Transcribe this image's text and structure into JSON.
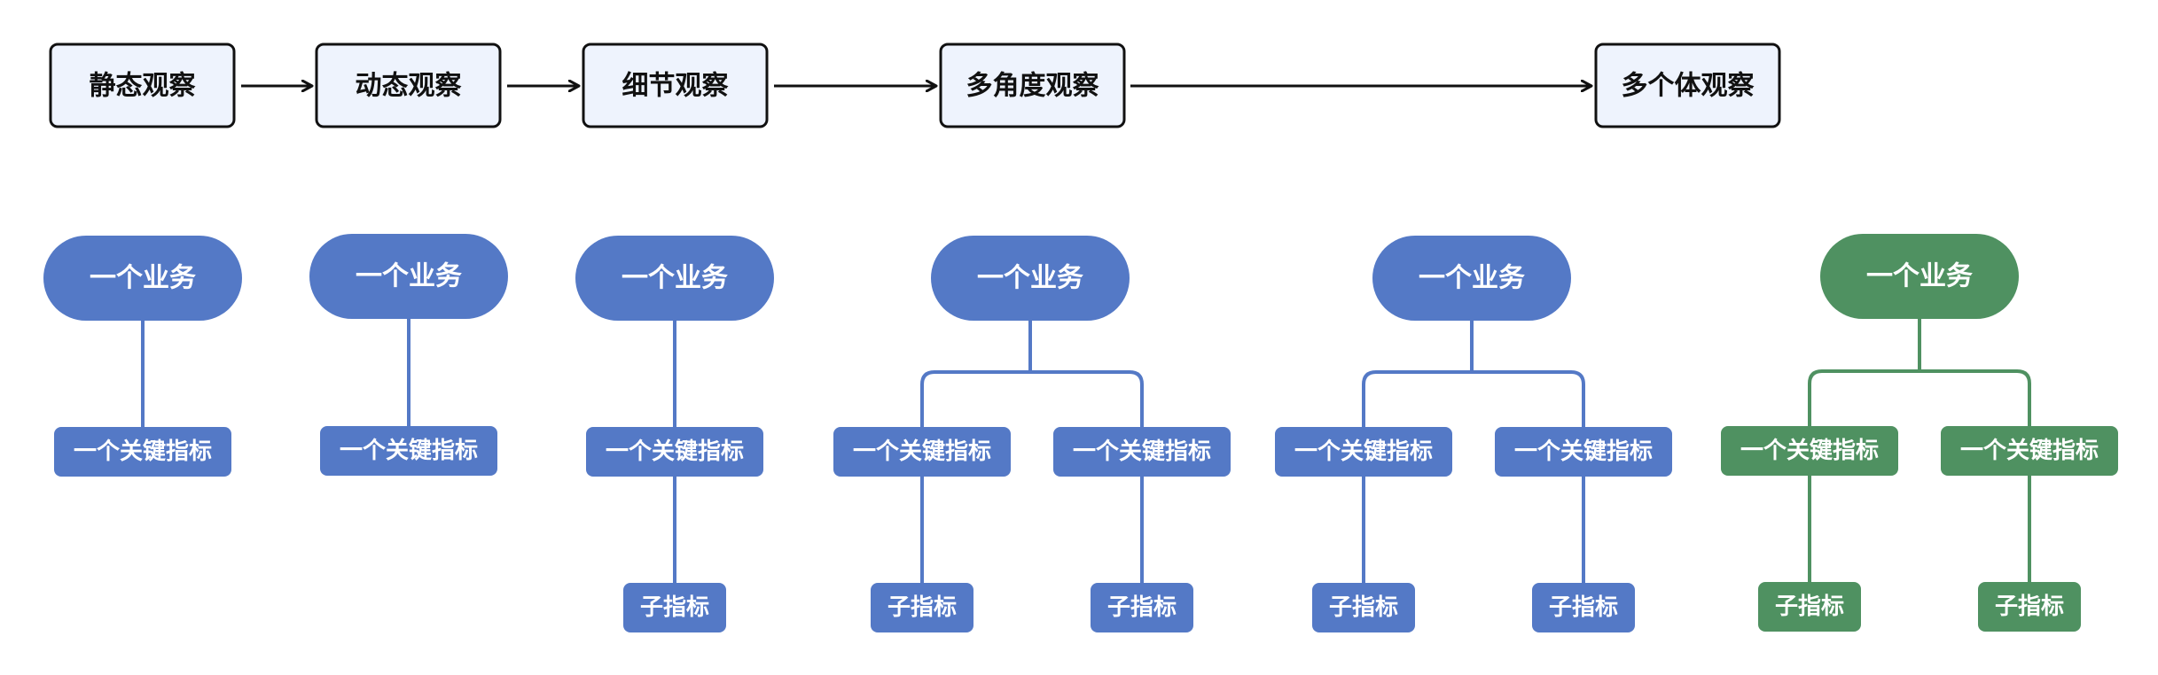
{
  "colors": {
    "blue": "#5479C6",
    "green": "#4F9161",
    "stage_fill": "#EEF3FD",
    "stage_border": "#111111"
  },
  "stages": [
    {
      "label": "静态观察"
    },
    {
      "label": "动态观察"
    },
    {
      "label": "细节观察"
    },
    {
      "label": "多角度观察"
    },
    {
      "label": "多个体观察"
    }
  ],
  "trees": [
    {
      "color": "blue",
      "business": "一个业务",
      "branches": [
        {
          "metric": "一个关键指标",
          "sub": null
        }
      ]
    },
    {
      "color": "blue",
      "business": "一个业务",
      "branches": [
        {
          "metric": "一个关键指标",
          "sub": null
        }
      ]
    },
    {
      "color": "blue",
      "business": "一个业务",
      "branches": [
        {
          "metric": "一个关键指标",
          "sub": "子指标"
        }
      ]
    },
    {
      "color": "blue",
      "business": "一个业务",
      "branches": [
        {
          "metric": "一个关键指标",
          "sub": "子指标"
        },
        {
          "metric": "一个关键指标",
          "sub": "子指标"
        }
      ]
    },
    {
      "color": "blue",
      "business": "一个业务",
      "branches": [
        {
          "metric": "一个关键指标",
          "sub": "子指标"
        },
        {
          "metric": "一个关键指标",
          "sub": "子指标"
        }
      ]
    },
    {
      "color": "green",
      "business": "一个业务",
      "branches": [
        {
          "metric": "一个关键指标",
          "sub": "子指标"
        },
        {
          "metric": "一个关键指标",
          "sub": "子指标"
        }
      ]
    }
  ]
}
